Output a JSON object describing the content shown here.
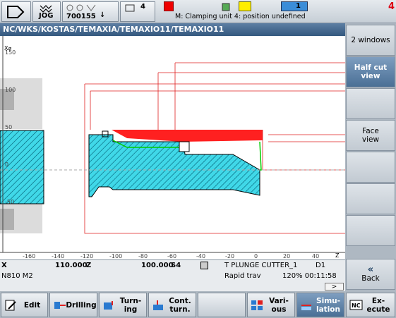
{
  "top": {
    "mode": "JOG",
    "program": "700155",
    "arrow": "↓",
    "channel_num": "4",
    "alarm": "M: Clamping unit 4: position undefined",
    "right_num": "1",
    "right_num2": "4"
  },
  "path": "NC/WKS/KOSTAS/TEMAXIA/TEMAXIO11/TEMAXIO11",
  "axis": {
    "x_label": "Z",
    "y_label": "X⌀",
    "x_ticks": [
      "-160",
      "-140",
      "-120",
      "-100",
      "-80",
      "-60",
      "-40",
      "-20",
      "0",
      "20",
      "40"
    ],
    "y_ticks": [
      "150",
      "100",
      "50",
      "0",
      "-50"
    ]
  },
  "info": {
    "row1": {
      "axis1": "X",
      "val1": "110.000",
      "axis2": "Z",
      "val2": "100.000",
      "sfx": "S4",
      "tool": "T PLUNGE CUTTER_1",
      "d": "D1"
    },
    "row2": {
      "block": "N810 M2",
      "mode": "Rapid trav",
      "stat": "120% 00:11:58"
    },
    "more": ">"
  },
  "vertical_softkeys": [
    "2 windows",
    "Half cut\nview",
    "",
    "Face\nview",
    "",
    "",
    "",
    ""
  ],
  "back_label": "Back",
  "bottom_softkeys": [
    "Edit",
    "Drilling",
    "Turn-\ning",
    "Cont.\nturn.",
    "",
    "Vari-\nous",
    "Simu-\nlation",
    "Ex-\necute"
  ]
}
